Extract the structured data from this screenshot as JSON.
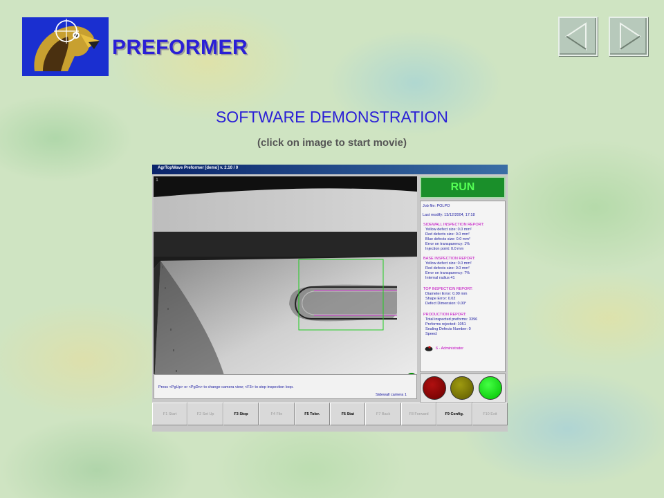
{
  "header": {
    "app_title": "PREFORMER",
    "logo_icon": "eagle-crosshair-icon",
    "nav": {
      "prev_icon": "triangle-left-icon",
      "next_icon": "triangle-right-icon"
    }
  },
  "main": {
    "subtitle": "SOFTWARE DEMONSTRATION",
    "hint": "(click on image to start movie)"
  },
  "movie": {
    "window_title": "AgrTopWave Preformer    [demo]    v. 2.10 / 0",
    "camera_index": "1",
    "status": "RUN",
    "report": {
      "job": "Job file:  POLPO",
      "modify": "Last modify:  13/12/2004, 17:18",
      "sidewall_title": "SIDEWALL INSPECTION REPORT:",
      "sidewall": [
        "Yellow defect size: 0.0 mm²",
        "Red defects size: 0.0 mm²",
        "Blue defects size: 0.0 mm²",
        "Error on transparency:  1%",
        "Injection point: 0.0 mm"
      ],
      "base_title": "BASE INSPECTION REPORT:",
      "base": [
        "Yellow defect size: 0.0 mm²",
        "Red defects size: 0.0 mm²",
        "Error on transparency:  7%",
        "Internal radius 41"
      ],
      "top_title": "TOP INSPECTION REPORT:",
      "top": [
        "Diameter Error: 0.00 mm",
        "Shape Error: 0.02",
        "Defect Dimension: 0.00°"
      ],
      "prod_title": "PRODUCTION REPORT:",
      "prod": [
        "Total inspected preforms: 3396",
        "Preforms rejected: 1051",
        "Sealing Defects Number:  0",
        "Speed:"
      ],
      "user": "6 - Administrator"
    },
    "message": "Press <PgUp> or <PgDn> to change camera view;  <F3> to stop inspection loop.",
    "camera_label": "Sidewall camera 1",
    "function_keys": [
      {
        "label": "F1 Start",
        "active": false
      },
      {
        "label": "F2 Set Up",
        "active": false
      },
      {
        "label": "F3 Stop",
        "active": true
      },
      {
        "label": "F4 File",
        "active": false
      },
      {
        "label": "F5 Toler.",
        "active": true
      },
      {
        "label": "F6 Stat",
        "active": true
      },
      {
        "label": "F7 Back",
        "active": false
      },
      {
        "label": "F8 Forward",
        "active": false
      },
      {
        "label": "F9 Config.",
        "active": true
      },
      {
        "label": "F10 Exit",
        "active": false
      }
    ],
    "colors": {
      "run_bg": "#1a8f2a",
      "run_text": "#55ff55",
      "roi_box": "#22cc22",
      "scan_line": "#cc33cc"
    }
  }
}
